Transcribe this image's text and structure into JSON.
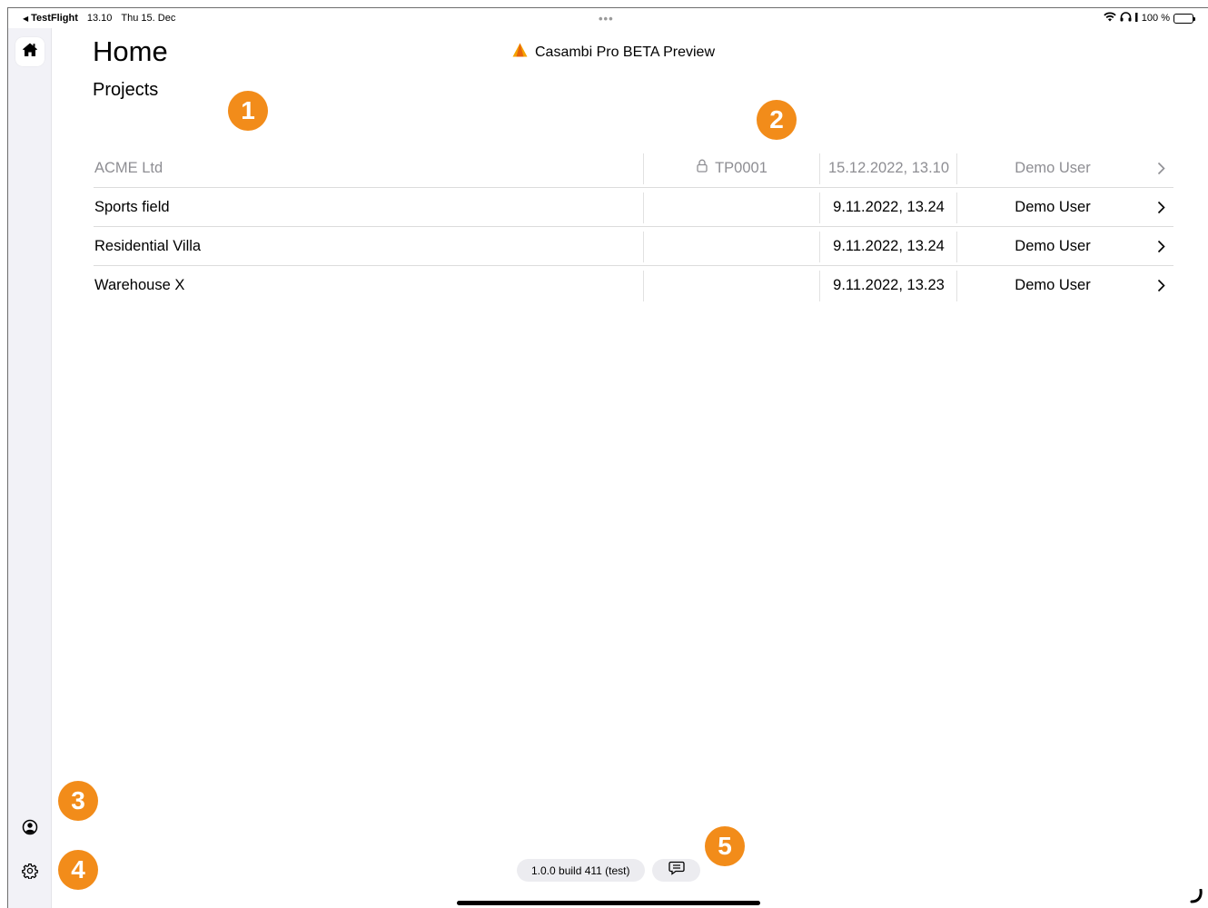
{
  "status_bar": {
    "back_app": "TestFlight",
    "time": "13.10",
    "date": "Thu 15. Dec",
    "multitask_dots": "•••",
    "battery": "100 %"
  },
  "header": {
    "title": "Home",
    "section": "Projects",
    "app_name": "Casambi Pro BETA Preview"
  },
  "sidebar": {
    "items": [
      {
        "name": "home",
        "icon": "house-icon"
      },
      {
        "name": "account",
        "icon": "person-circle-icon"
      },
      {
        "name": "settings",
        "icon": "gear-icon"
      }
    ]
  },
  "projects": [
    {
      "name": "ACME Ltd",
      "code": "TP0001",
      "locked": true,
      "modified": "15.12.2022, 13.10",
      "user": "Demo User",
      "dimmed": true
    },
    {
      "name": "Sports field",
      "code": "",
      "locked": false,
      "modified": "9.11.2022, 13.24",
      "user": "Demo User",
      "dimmed": false
    },
    {
      "name": "Residential Villa",
      "code": "",
      "locked": false,
      "modified": "9.11.2022, 13.24",
      "user": "Demo User",
      "dimmed": false
    },
    {
      "name": "Warehouse X",
      "code": "",
      "locked": false,
      "modified": "9.11.2022, 13.23",
      "user": "Demo User",
      "dimmed": false
    }
  ],
  "markers": [
    "1",
    "2",
    "3",
    "4",
    "5"
  ],
  "footer": {
    "version": "1.0.0 build 411 (test)"
  },
  "colors": {
    "marker": "#f28c1a",
    "sidebar_bg": "#f2f2f7",
    "dim_text": "#8e8e93"
  }
}
